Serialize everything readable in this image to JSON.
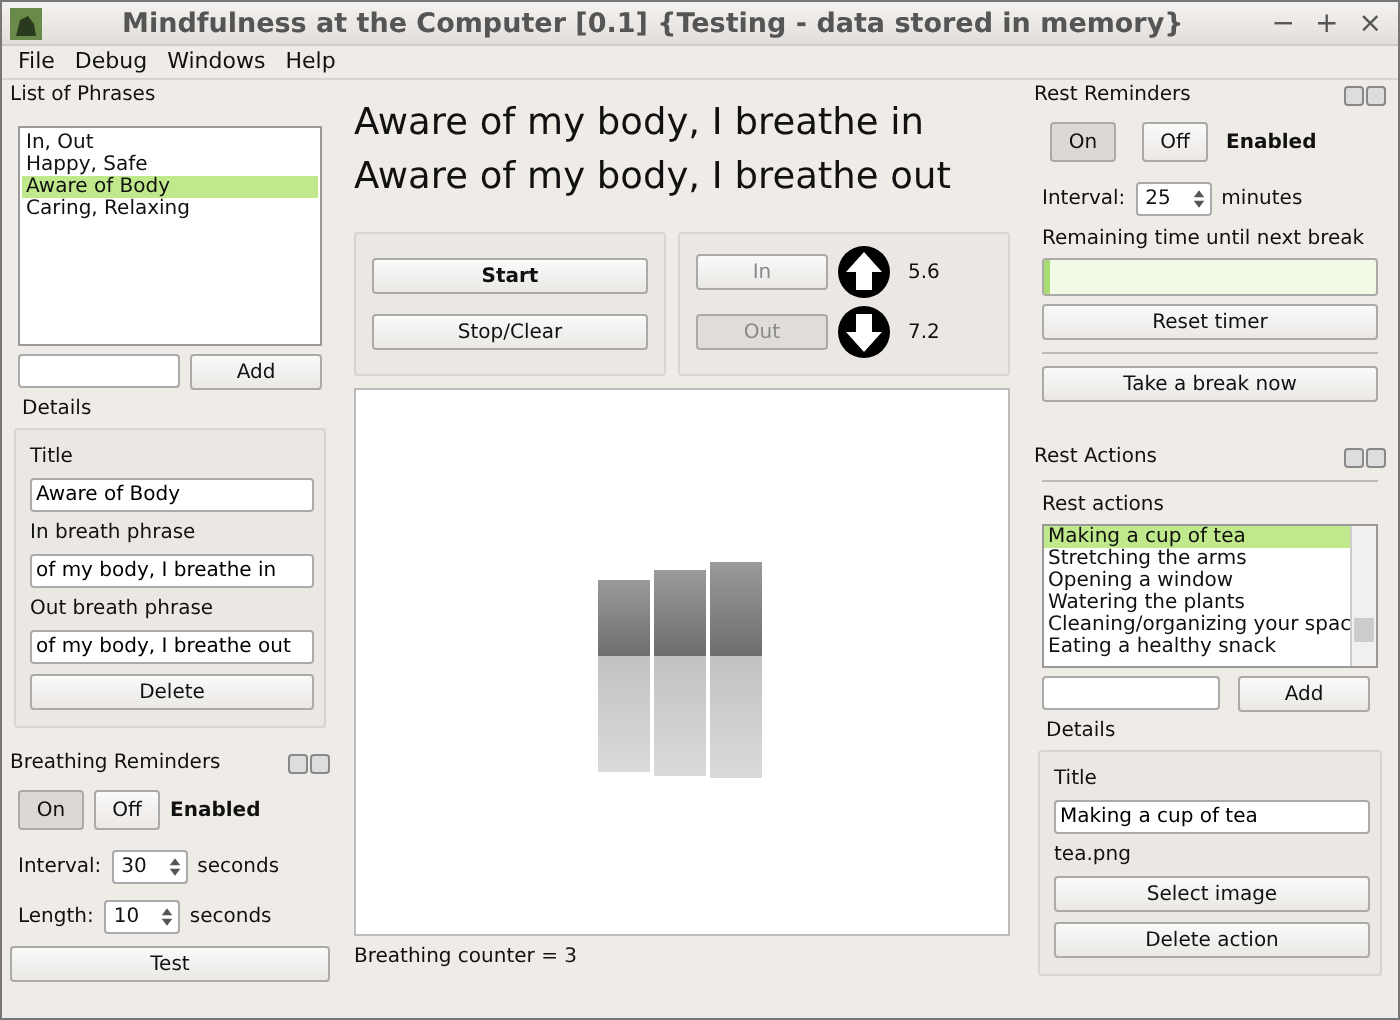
{
  "window": {
    "title": "Mindfulness at the Computer [0.1] {Testing - data stored in memory}",
    "controls": [
      "−",
      "+",
      "×"
    ]
  },
  "menu": [
    "File",
    "Debug",
    "Windows",
    "Help"
  ],
  "phrases": {
    "title": "List of Phrases",
    "items": [
      {
        "label": "In, Out",
        "selected": false
      },
      {
        "label": "Happy, Safe",
        "selected": false
      },
      {
        "label": "Aware of Body",
        "selected": true
      },
      {
        "label": "Caring, Relaxing",
        "selected": false
      }
    ],
    "add_button": "Add",
    "details": {
      "heading": "Details",
      "title_label": "Title",
      "title_value": "Aware of Body",
      "in_label": "In breath phrase",
      "in_value": "of my body, I breathe in",
      "out_label": "Out breath phrase",
      "out_value": "of my body, I breathe out",
      "delete_button": "Delete"
    }
  },
  "breathing_reminders": {
    "title": "Breathing Reminders",
    "on": {
      "label": "On",
      "selected": true
    },
    "off": {
      "label": "Off",
      "selected": false
    },
    "status": "Enabled",
    "interval_label": "Interval:",
    "interval_value": "30",
    "interval_unit": "seconds",
    "length_label": "Length:",
    "length_value": "10",
    "length_unit": "seconds",
    "test_button": "Test"
  },
  "main": {
    "in_phrase": "Aware of my body, I breathe in",
    "out_phrase": "Aware of my body, I breathe out",
    "start_button": "Start",
    "stop_button": "Stop/Clear",
    "breath_buttons": [
      {
        "label": "In",
        "kind": "up",
        "disabled": true,
        "pressed": false,
        "reading": "5.6"
      },
      {
        "label": "Out",
        "kind": "down",
        "disabled": true,
        "pressed": true,
        "reading": "7.2"
      }
    ],
    "counter": "Breathing counter = 3"
  },
  "rest_reminders": {
    "title": "Rest Reminders",
    "on": {
      "label": "On",
      "selected": true
    },
    "off": {
      "label": "Off",
      "selected": false
    },
    "status": "Enabled",
    "interval_label": "Interval:",
    "interval_value": "25",
    "interval_unit": "minutes",
    "remaining_label": "Remaining time until next break",
    "remaining": {
      "level": 0.02
    },
    "reset_button": "Reset timer",
    "break_button": "Take a break now"
  },
  "rest_actions": {
    "title": "Rest Actions",
    "list_label": "Rest actions",
    "items": [
      {
        "label": "Making a cup of tea",
        "selected": true
      },
      {
        "label": "Stretching the arms",
        "selected": false
      },
      {
        "label": "Opening a window",
        "selected": false
      },
      {
        "label": "Watering the plants",
        "selected": false
      },
      {
        "label": "Cleaning/organizing your spac",
        "selected": false
      },
      {
        "label": "Eating a healthy snack",
        "selected": false
      }
    ],
    "add_button": "Add",
    "details": {
      "heading": "Details",
      "title_label": "Title",
      "title_value": "Making a cup of tea",
      "image_name": "tea.png",
      "select_button": "Select image",
      "delete_button": "Delete action"
    }
  }
}
